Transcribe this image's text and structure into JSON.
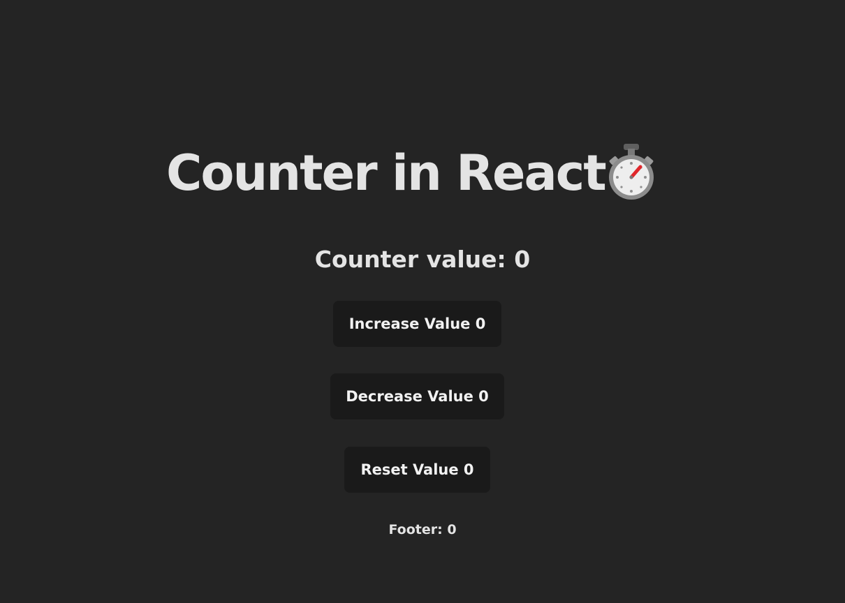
{
  "header": {
    "title": "Counter in React",
    "emoji_icon": "stopwatch-icon"
  },
  "counter": {
    "label": "Counter value: 0",
    "value": 0
  },
  "buttons": {
    "increase_label": "Increase Value 0",
    "decrease_label": "Decrease Value 0",
    "reset_label": "Reset Value 0"
  },
  "footer": {
    "text": "Footer: 0"
  },
  "colors": {
    "background": "#242424",
    "button_background": "#1a1a1a",
    "text": "#e4e4e4",
    "stopwatch_hand": "#e0262b"
  }
}
